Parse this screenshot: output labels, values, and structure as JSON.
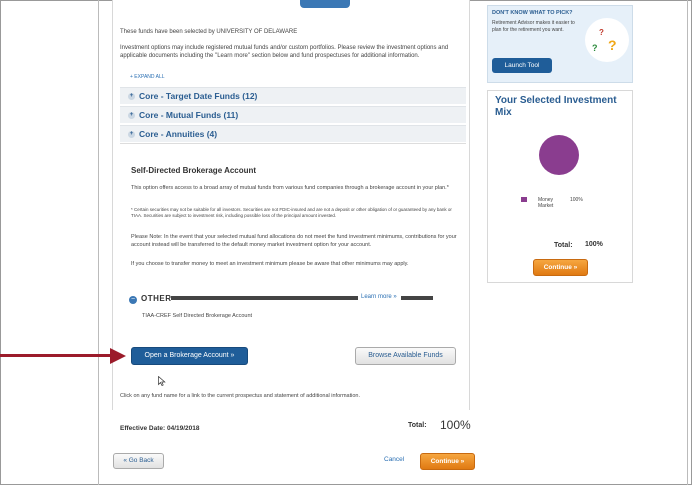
{
  "intro": {
    "selected_by": "These funds have been selected by UNIVERSITY OF DELAWARE",
    "options": "Investment options may include registered mutual funds and/or custom portfolios. Please review the investment options and applicable documents including the \"Learn more\" section below and fund prospectuses for additional information.",
    "expand_all": "+ EXPAND ALL"
  },
  "accordion": [
    {
      "label": "Core - Target Date Funds (12)",
      "icon": "plus-icon"
    },
    {
      "label": "Core - Mutual Funds (11)",
      "icon": "plus-icon"
    },
    {
      "label": "Core - Annuities (4)",
      "icon": "plus-icon"
    }
  ],
  "brokerage": {
    "title": "Self-Directed Brokerage Account",
    "desc": "This option offers access to a broad array of mutual funds from various fund companies through a brokerage account in your plan.*",
    "footnote": "* Certain securities may not be suitable for all investors. Securities are not FDIC-insured and are not a deposit or other obligation of or guaranteed by any bank or TIAA. Securities are subject to investment risk, including possible loss of the principal amount invested.",
    "note": "Please Note: In the event that your selected mutual fund allocations do not meet the fund investment minimums, contributions for your account instead will be transferred to the default money market investment option for your account.",
    "transfer": "If you choose to transfer money to meet an investment minimum please be aware that other minimums may apply.",
    "other_label": "OTHER",
    "learn_more": "Learn more »",
    "account_name": "TIAA-CREF Self Directed Brokerage Account",
    "open_button": "Open a Brokerage Account »",
    "browse_button": "Browse Available Funds",
    "click_note": "Click on any fund name for a link to the current prospectus and statement of additional information."
  },
  "footer": {
    "effective_date": "Effective Date: 04/19/2018",
    "total_label": "Total:",
    "total_value": "100%",
    "back_button": "« Go Back",
    "cancel_link": "Cancel",
    "continue_button": "Continue »"
  },
  "tool": {
    "header": "DON'T KNOW WHAT TO PICK?",
    "text": "Retirement Advisor makes it easier to plan for the retirement you want.",
    "button": "Launch Tool",
    "q1": "?",
    "q2": "?",
    "q3": "?"
  },
  "mix": {
    "title": "Your Selected Investment Mix",
    "legend_label": "Money Market",
    "legend_pct": "100%",
    "total_label": "Total:",
    "total_value": "100%",
    "continue_button": "Continue »",
    "slice_color": "#8a3d8f"
  },
  "colors": {
    "accent": "#2a5d91",
    "primary_button": "#1f5d99",
    "continue_button": "#e8861e",
    "arrow": "#9b1b2a"
  }
}
